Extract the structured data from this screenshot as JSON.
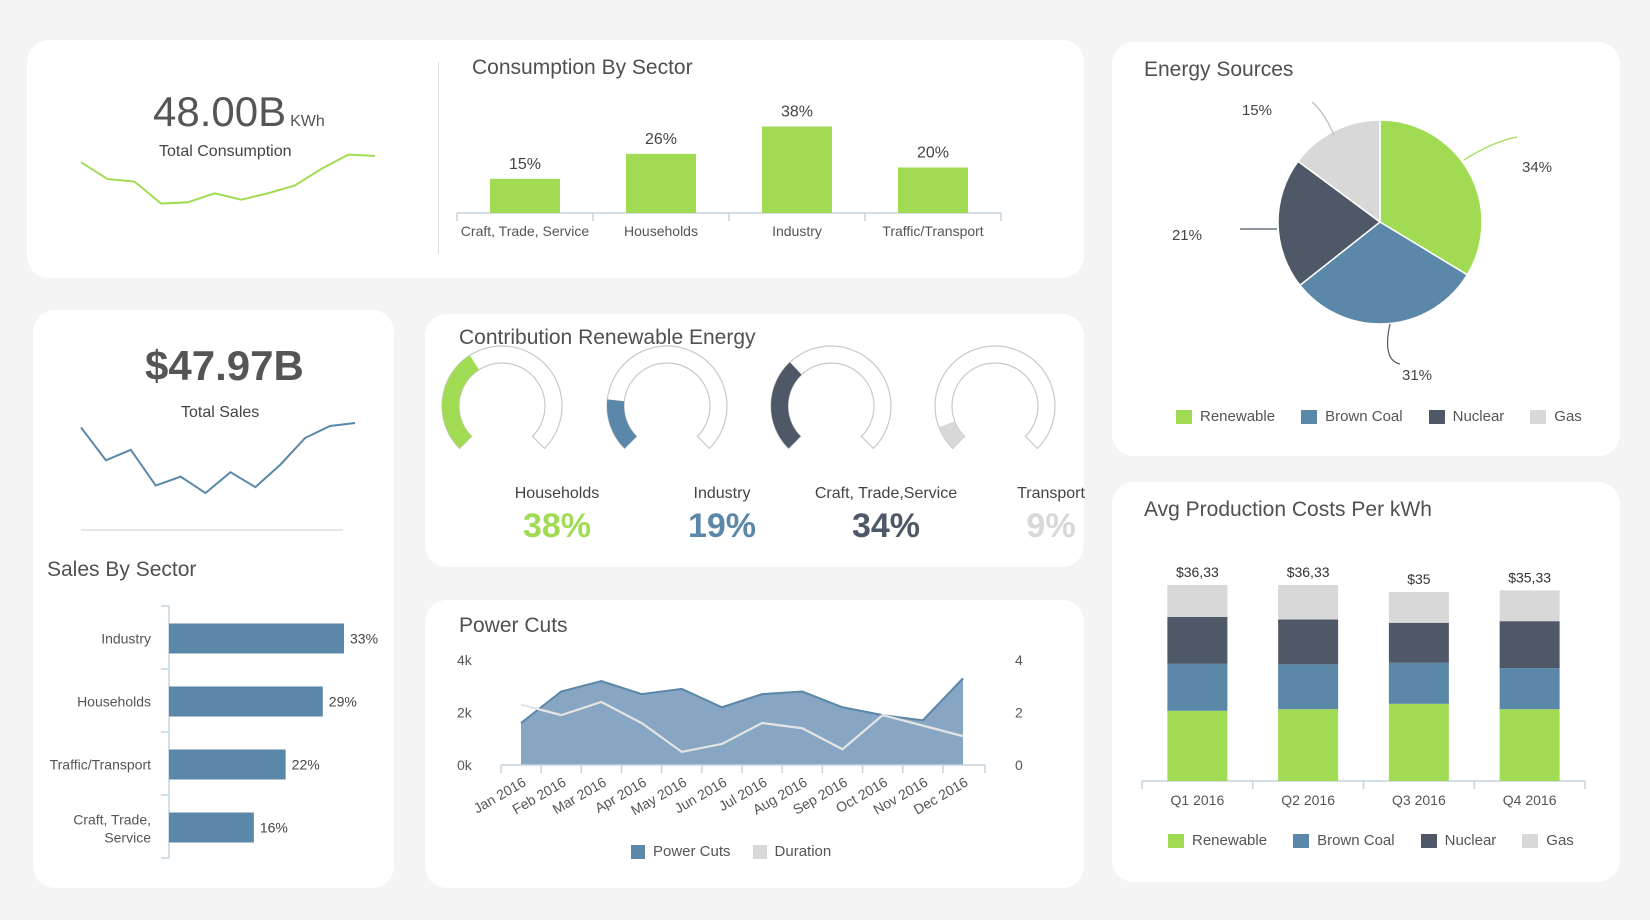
{
  "colors": {
    "green": "#a1db53",
    "blue": "#5b87a8",
    "dark": "#4e5866",
    "gray": "#d8d8d8",
    "area": "#86a6c3",
    "axis": "#c5d3df",
    "title": "#505050"
  },
  "consumption_kpi": {
    "value": "48.00B",
    "unit": "KWh",
    "label": "Total Consumption",
    "sparkline": [
      6.2,
      4.9,
      4.7,
      3.0,
      3.1,
      3.8,
      3.3,
      3.8,
      4.4,
      5.7,
      6.8,
      6.7
    ]
  },
  "sales_kpi": {
    "value": "$47.97B",
    "label": "Total Sales",
    "sparkline": [
      6.5,
      4.3,
      5.0,
      2.6,
      3.2,
      2.1,
      3.5,
      2.5,
      4.0,
      5.8,
      6.6,
      6.8
    ]
  },
  "consumption_by_sector": {
    "title": "Consumption By Sector",
    "chart_data": {
      "type": "bar",
      "categories": [
        "Craft, Trade, Service",
        "Households",
        "Industry",
        "Traffic/Transport"
      ],
      "values": [
        15,
        26,
        38,
        20
      ],
      "labels": [
        "15%",
        "26%",
        "38%",
        "20%"
      ],
      "ylim": [
        0,
        40
      ]
    }
  },
  "energy_sources": {
    "title": "Energy Sources",
    "chart_data": {
      "type": "pie",
      "categories": [
        "Renewable",
        "Brown Coal",
        "Nuclear",
        "Gas"
      ],
      "values": [
        34,
        31,
        21,
        15
      ],
      "labels": [
        "34%",
        "31%",
        "21%",
        "15%"
      ],
      "legend_position": "bottom"
    },
    "legend": [
      "Renewable",
      "Brown Coal",
      "Nuclear",
      "Gas"
    ]
  },
  "sales_by_sector": {
    "title": "Sales By Sector",
    "chart_data": {
      "type": "bar",
      "orientation": "horizontal",
      "categories": [
        "Industry",
        "Households",
        "Traffic/Transport",
        "Craft, Trade, Service"
      ],
      "values": [
        33,
        29,
        22,
        16
      ],
      "labels": [
        "33%",
        "29%",
        "22%",
        "16%"
      ],
      "xlim": [
        0,
        33
      ]
    }
  },
  "renewable_contribution": {
    "title": "Contribution Renewable Energy",
    "gauges": [
      {
        "name": "Households",
        "pct": "38%",
        "value": 38,
        "color": "#a1db53"
      },
      {
        "name": "Industry",
        "pct": "19%",
        "value": 19,
        "color": "#5b87a8"
      },
      {
        "name": "Craft, Trade,Service",
        "pct": "34%",
        "value": 34,
        "color": "#4e5866"
      },
      {
        "name": "Transport",
        "pct": "9%",
        "value": 9,
        "color": "#d8d8d8"
      }
    ]
  },
  "power_cuts": {
    "title": "Power Cuts",
    "legend": [
      "Power Cuts",
      "Duration"
    ],
    "chart_data": {
      "type": "area",
      "categories": [
        "Jan 2016",
        "Feb 2016",
        "Mar 2016",
        "Apr 2016",
        "May 2016",
        "Jun 2016",
        "Jul 2016",
        "Aug 2016",
        "Sep 2016",
        "Oct 2016",
        "Nov 2016",
        "Dec 2016"
      ],
      "series": [
        {
          "name": "Power Cuts",
          "values": [
            1600,
            2800,
            3200,
            2700,
            2900,
            2200,
            2700,
            2800,
            2200,
            1900,
            1700,
            3300
          ],
          "axis": "left"
        },
        {
          "name": "Duration",
          "values": [
            2.3,
            1.9,
            2.4,
            1.6,
            0.5,
            0.8,
            1.6,
            1.4,
            0.6,
            1.9,
            1.5,
            1.1
          ],
          "axis": "right"
        }
      ],
      "ylim_left": [
        0,
        4000
      ],
      "yticks_left": [
        "0k",
        "2k",
        "4k"
      ],
      "ylim_right": [
        0,
        4
      ],
      "yticks_right": [
        "0",
        "2",
        "4"
      ]
    }
  },
  "production_costs": {
    "title": "Avg Production Costs Per kWh",
    "legend": [
      "Renewable",
      "Brown Coal",
      "Nuclear",
      "Gas"
    ],
    "chart_data": {
      "type": "bar",
      "stacked": true,
      "categories": [
        "Q1 2016",
        "Q2 2016",
        "Q3 2016",
        "Q4 2016"
      ],
      "totals_labels": [
        "$36,33",
        "$36,33",
        "$35",
        "$35,33"
      ],
      "series": [
        {
          "name": "Renewable",
          "values": [
            13.0,
            13.3,
            14.3,
            13.3
          ]
        },
        {
          "name": "Brown Coal",
          "values": [
            8.7,
            8.3,
            7.6,
            7.6
          ]
        },
        {
          "name": "Nuclear",
          "values": [
            8.7,
            8.3,
            7.4,
            8.7
          ]
        },
        {
          "name": "Gas",
          "values": [
            5.9,
            6.4,
            5.7,
            5.7
          ]
        }
      ]
    }
  }
}
